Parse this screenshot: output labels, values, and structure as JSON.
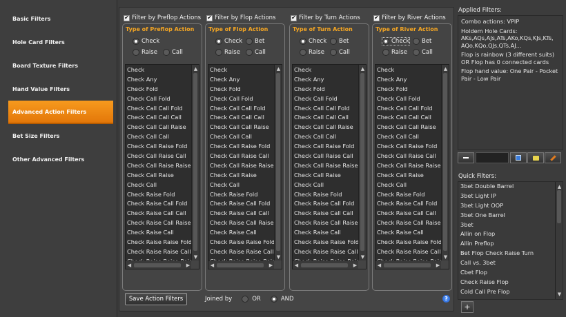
{
  "sidebar": {
    "items": [
      {
        "label": "Basic Filters",
        "active": false
      },
      {
        "label": "Hole Card Filters",
        "active": false
      },
      {
        "label": "Board Texture Filters",
        "active": false
      },
      {
        "label": "Hand Value Filters",
        "active": false
      },
      {
        "label": "Advanced Action Filters",
        "active": true
      },
      {
        "label": "Bet Size Filters",
        "active": false
      },
      {
        "label": "Other Advanced Filters",
        "active": false
      }
    ]
  },
  "columns": [
    {
      "checkbox": "Filter by Preflop Actions",
      "checked": true,
      "title": "Type of Preflop Action",
      "radios": [
        {
          "label": "Check",
          "selected": true
        },
        {
          "label": "Raise",
          "selected": false
        },
        {
          "label": "Call",
          "selected": false
        }
      ],
      "items": [
        "Check",
        "Check Any",
        "Check Fold",
        "Check Call Fold",
        "Check Call Call Fold",
        "Check Call Call Call",
        "Check Call Call Raise",
        "Check Call Call",
        "Check Call Raise Fold",
        "Check Call Raise Call",
        "Check Call Raise Raise",
        "Check Call Raise",
        "Check Call",
        "Check Raise Fold",
        "Check Raise Call Fold",
        "Check Raise Call Call",
        "Check Raise Call Raise",
        "Check Raise Call",
        "Check Raise Raise Fold",
        "Check Raise Raise Call",
        "Check Raise Raise Raise"
      ]
    },
    {
      "checkbox": "Filter by Flop Actions",
      "checked": true,
      "title": "Type of Flop Action",
      "radios": [
        {
          "label": "Check",
          "selected": true
        },
        {
          "label": "Bet",
          "selected": false
        },
        {
          "label": "Raise",
          "selected": false
        },
        {
          "label": "Call",
          "selected": false
        }
      ],
      "items": [
        "Check",
        "Check Any",
        "Check Fold",
        "Check Call Fold",
        "Check Call Call Fold",
        "Check Call Call Call",
        "Check Call Call Raise",
        "Check Call Call",
        "Check Call Raise Fold",
        "Check Call Raise Call",
        "Check Call Raise Raise",
        "Check Call Raise",
        "Check Call",
        "Check Raise Fold",
        "Check Raise Call Fold",
        "Check Raise Call Call",
        "Check Raise Call Raise",
        "Check Raise Call",
        "Check Raise Raise Fold",
        "Check Raise Raise Call",
        "Check Raise Raise Raise"
      ]
    },
    {
      "checkbox": "Filter by Turn Actions",
      "checked": true,
      "title": "Type of Turn Action",
      "radios": [
        {
          "label": "Check",
          "selected": true
        },
        {
          "label": "Bet",
          "selected": false
        },
        {
          "label": "Raise",
          "selected": false
        },
        {
          "label": "Call",
          "selected": false
        }
      ],
      "items": [
        "Check",
        "Check Any",
        "Check Fold",
        "Check Call Fold",
        "Check Call Call Fold",
        "Check Call Call Call",
        "Check Call Call Raise",
        "Check Call Call",
        "Check Call Raise Fold",
        "Check Call Raise Call",
        "Check Call Raise Raise",
        "Check Call Raise",
        "Check Call",
        "Check Raise Fold",
        "Check Raise Call Fold",
        "Check Raise Call Call",
        "Check Raise Call Raise",
        "Check Raise Call",
        "Check Raise Raise Fold",
        "Check Raise Raise Call",
        "Check Raise Raise Raise"
      ]
    },
    {
      "checkbox": "Filter by River Actions",
      "checked": true,
      "title": "Type of River Action",
      "radios": [
        {
          "label": "Check",
          "selected": true
        },
        {
          "label": "Bet",
          "selected": false
        },
        {
          "label": "Raise",
          "selected": false
        },
        {
          "label": "Call",
          "selected": false
        }
      ],
      "items": [
        "Check",
        "Check Any",
        "Check Fold",
        "Check Call Fold",
        "Check Call Call Fold",
        "Check Call Call Call",
        "Check Call Call Raise",
        "Check Call Call",
        "Check Call Raise Fold",
        "Check Call Raise Call",
        "Check Call Raise Raise",
        "Check Call Raise",
        "Check Call",
        "Check Raise Fold",
        "Check Raise Call Fold",
        "Check Raise Call Call",
        "Check Raise Call Raise",
        "Check Raise Call",
        "Check Raise Raise Fold",
        "Check Raise Raise Call",
        "Check Raise Raise Raise"
      ]
    }
  ],
  "footer": {
    "save_label": "Save Action Filters",
    "joined_label": "Joined by",
    "or_label": "OR",
    "and_label": "AND",
    "joined_value": "AND",
    "help": "?"
  },
  "applied": {
    "title": "Applied Filters:",
    "lines": [
      "Combo actions: VPIP",
      "Holdem Hole Cards: AKs,AQs,AJs,ATs,AKo,KQs,KJs,KTs, AQo,KQo,QJs,QTs,AJ...",
      "Flop is rainbow (3 different suits) OR Flop has 0 connected cards",
      "Flop hand value: One Pair - Pocket Pair - Low Pair"
    ],
    "remove_icon": "minus-icon",
    "tool_icons": [
      "save-icon",
      "load-icon",
      "edit-icon"
    ]
  },
  "quick": {
    "title": "Quick Filters:",
    "items": [
      "3bet Double Barrel",
      "3bet Light IP",
      "3bet Light OOP",
      "3bet One Barrel",
      "3bet",
      "Allin on Flop",
      "Allin Preflop",
      "Bet Flop Check Raise Turn",
      "Call vs. 3bet",
      "Cbet Flop",
      "Check Raise Flop",
      "Cold Call Pre Flop"
    ],
    "add": "+"
  }
}
